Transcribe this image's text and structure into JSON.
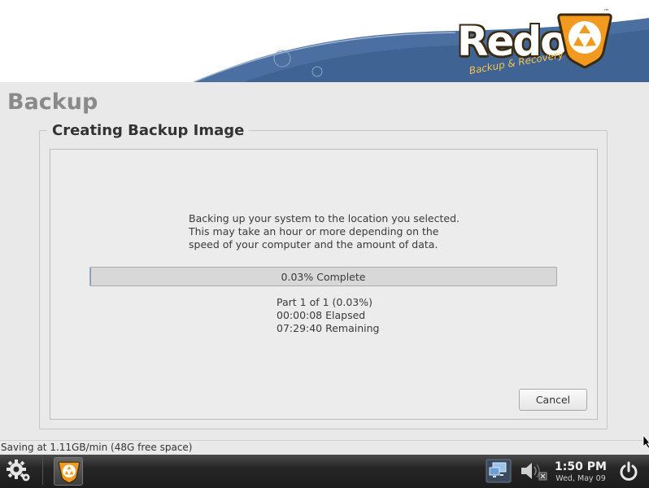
{
  "header": {
    "logo_word": "Redo",
    "logo_tagline": "Backup & Recovery",
    "logo_tm": "™"
  },
  "page": {
    "title": "Backup"
  },
  "group": {
    "title": "Creating Backup Image",
    "message_lines": [
      "Backing up your system to the location you selected.",
      "This may take an hour or more depending on the",
      "speed of your computer and the amount of data."
    ],
    "progress": {
      "percent": 0.03,
      "label": "0.03% Complete"
    },
    "stats": {
      "part": "Part 1 of 1 (0.03%)",
      "elapsed": "00:00:08 Elapsed",
      "remaining": "07:29:40 Remaining"
    },
    "cancel_label": "Cancel"
  },
  "status": {
    "text": "Saving at 1.11GB/min (48G free space)"
  },
  "taskbar": {
    "menu_icon": "gear-icon",
    "app_icon": "redo-recycle-icon",
    "network_icon": "network-icon",
    "volume_icon": "volume-muted-icon",
    "time": "1:50 PM",
    "date": "Wed, May 09",
    "power_icon": "power-icon"
  },
  "colors": {
    "banner_blue": "#4a6fa0",
    "logo_orange": "#f29a1f",
    "progress_fill": "#7a9cc7"
  }
}
